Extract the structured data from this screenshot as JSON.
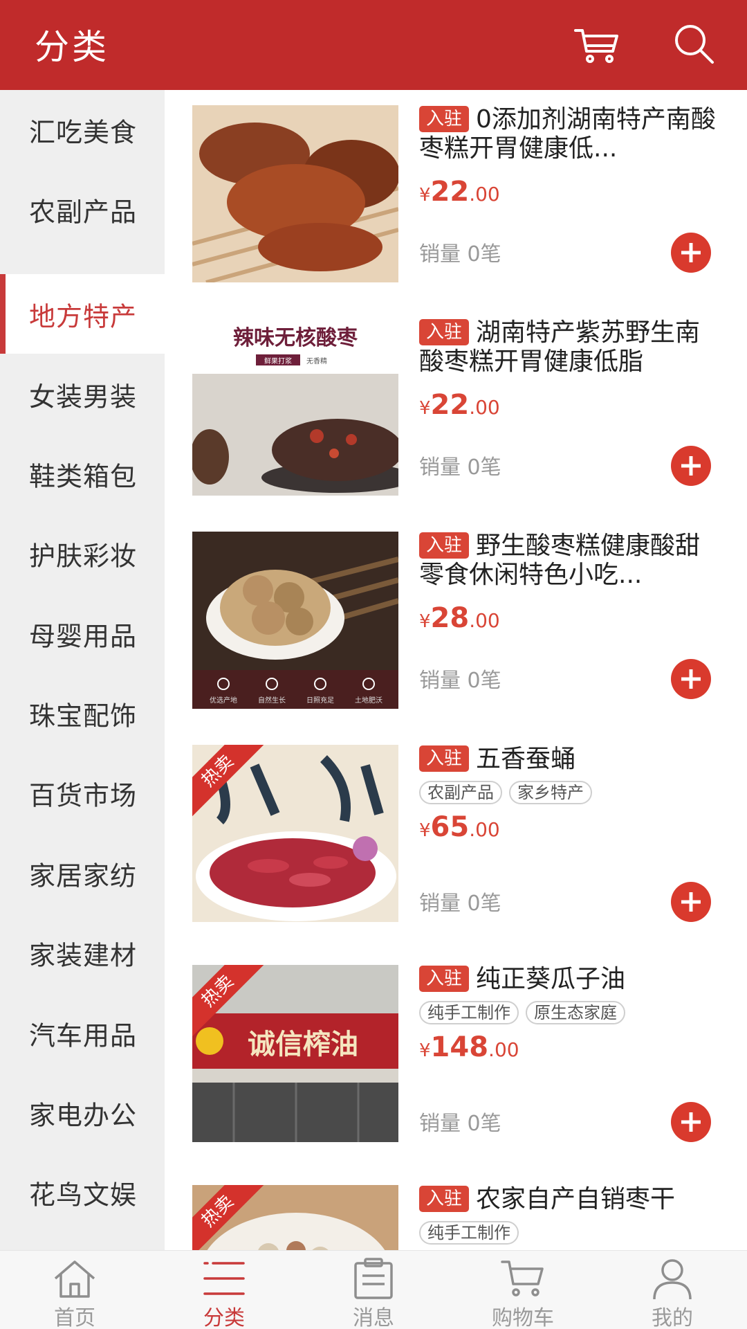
{
  "header": {
    "title": "分类",
    "cart_icon": "cart-icon",
    "search_icon": "search-icon"
  },
  "sidebar": {
    "active_index": 2,
    "items": [
      {
        "label": "汇吃美食"
      },
      {
        "label": "农副产品"
      },
      {
        "label": "地方特产"
      },
      {
        "label": "女装男装"
      },
      {
        "label": "鞋类箱包"
      },
      {
        "label": "护肤彩妆"
      },
      {
        "label": "母婴用品"
      },
      {
        "label": "珠宝配饰"
      },
      {
        "label": "百货市场"
      },
      {
        "label": "家居家纺"
      },
      {
        "label": "家装建材"
      },
      {
        "label": "汽车用品"
      },
      {
        "label": "家电办公"
      },
      {
        "label": "花鸟文娱"
      }
    ]
  },
  "products": [
    {
      "badge": "入驻",
      "name": "0添加剂湖南特产南酸枣糕开胃健康低...",
      "tags": [],
      "price_symbol": "¥",
      "price_int": "22",
      "price_dec": ".00",
      "sales": "销量 0笔",
      "ribbon": ""
    },
    {
      "badge": "入驻",
      "name": "湖南特产紫苏野生南酸枣糕开胃健康低脂",
      "tags": [],
      "price_symbol": "¥",
      "price_int": "22",
      "price_dec": ".00",
      "sales": "销量 0笔",
      "ribbon": "",
      "img_title": "辣味无核酸枣",
      "img_sub1": "鲜果打浆",
      "img_sub2": "无香精"
    },
    {
      "badge": "入驻",
      "name": "野生酸枣糕健康酸甜零食休闲特色小吃...",
      "tags": [],
      "price_symbol": "¥",
      "price_int": "28",
      "price_dec": ".00",
      "sales": "销量 0笔",
      "ribbon": "",
      "img_icons": [
        "优选产地",
        "自然生长",
        "日照充足",
        "土地肥沃"
      ]
    },
    {
      "badge": "入驻",
      "name": "五香蚕蛹",
      "tags": [
        "农副产品",
        "家乡特产"
      ],
      "price_symbol": "¥",
      "price_int": "65",
      "price_dec": ".00",
      "sales": "销量 0笔",
      "ribbon": "热卖"
    },
    {
      "badge": "入驻",
      "name": "纯正葵瓜子油",
      "tags": [
        "纯手工制作",
        "原生态家庭"
      ],
      "price_symbol": "¥",
      "price_int": "148",
      "price_dec": ".00",
      "sales": "销量 0笔",
      "ribbon": "热卖",
      "img_sign": "诚信榨油"
    },
    {
      "badge": "入驻",
      "name": "农家自产自销枣干",
      "tags": [
        "纯手工制作"
      ],
      "price_symbol": "¥",
      "price_int": "",
      "price_dec": "",
      "sales": "",
      "ribbon": "热卖"
    }
  ],
  "bottom_nav": {
    "active_index": 1,
    "items": [
      {
        "label": "首页",
        "icon": "home-icon"
      },
      {
        "label": "分类",
        "icon": "category-list-icon"
      },
      {
        "label": "消息",
        "icon": "message-icon"
      },
      {
        "label": "购物车",
        "icon": "cart-icon"
      },
      {
        "label": "我的",
        "icon": "user-icon"
      }
    ]
  },
  "colors": {
    "brand": "#c02b2b",
    "accent": "#d94536",
    "sidebar_bg": "#efefef"
  }
}
